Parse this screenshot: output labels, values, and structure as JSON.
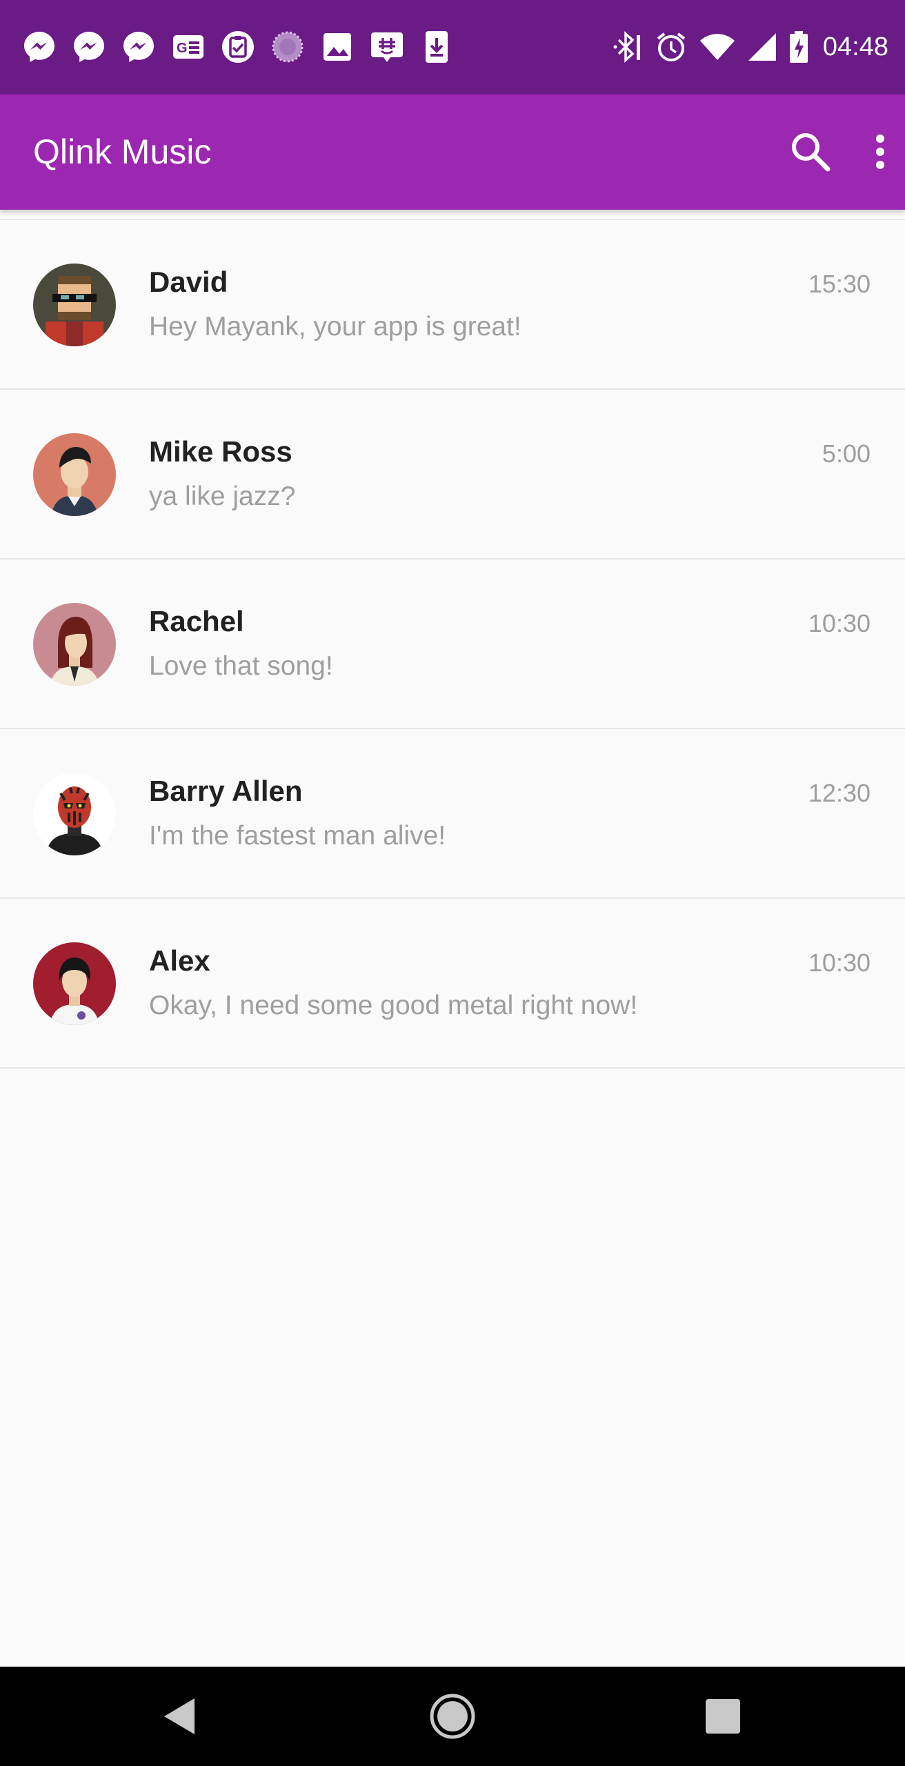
{
  "status_bar": {
    "time": "04:48",
    "notification_icons": [
      "messenger-icon",
      "messenger-icon",
      "messenger-icon",
      "gmail-news-icon",
      "clipboard-check-icon",
      "loading-circle-icon",
      "image-icon",
      "groupme-icon",
      "download-icon"
    ],
    "system_icons": [
      "bluetooth-icon",
      "alarm-icon",
      "wifi-icon",
      "signal-icon",
      "battery-charging-icon"
    ]
  },
  "app_bar": {
    "title": "Qlink Music",
    "actions": [
      "search-icon",
      "more-vert-icon"
    ]
  },
  "conversations": [
    {
      "name": "David",
      "message": "Hey Mayank, your app is great!",
      "time": "15:30"
    },
    {
      "name": "Mike Ross",
      "message": "ya like jazz?",
      "time": "5:00"
    },
    {
      "name": "Rachel",
      "message": "Love that song!",
      "time": "10:30"
    },
    {
      "name": "Barry Allen",
      "message": "I'm the fastest man alive!",
      "time": "12:30"
    },
    {
      "name": "Alex",
      "message": "Okay, I need some good metal right now!",
      "time": "10:30"
    }
  ],
  "nav_bar": {
    "buttons": [
      "back-icon",
      "home-icon",
      "recents-icon"
    ]
  },
  "colors": {
    "status_bar": "#6a1b86",
    "app_bar": "#9c27b0",
    "background": "#fafafa"
  }
}
